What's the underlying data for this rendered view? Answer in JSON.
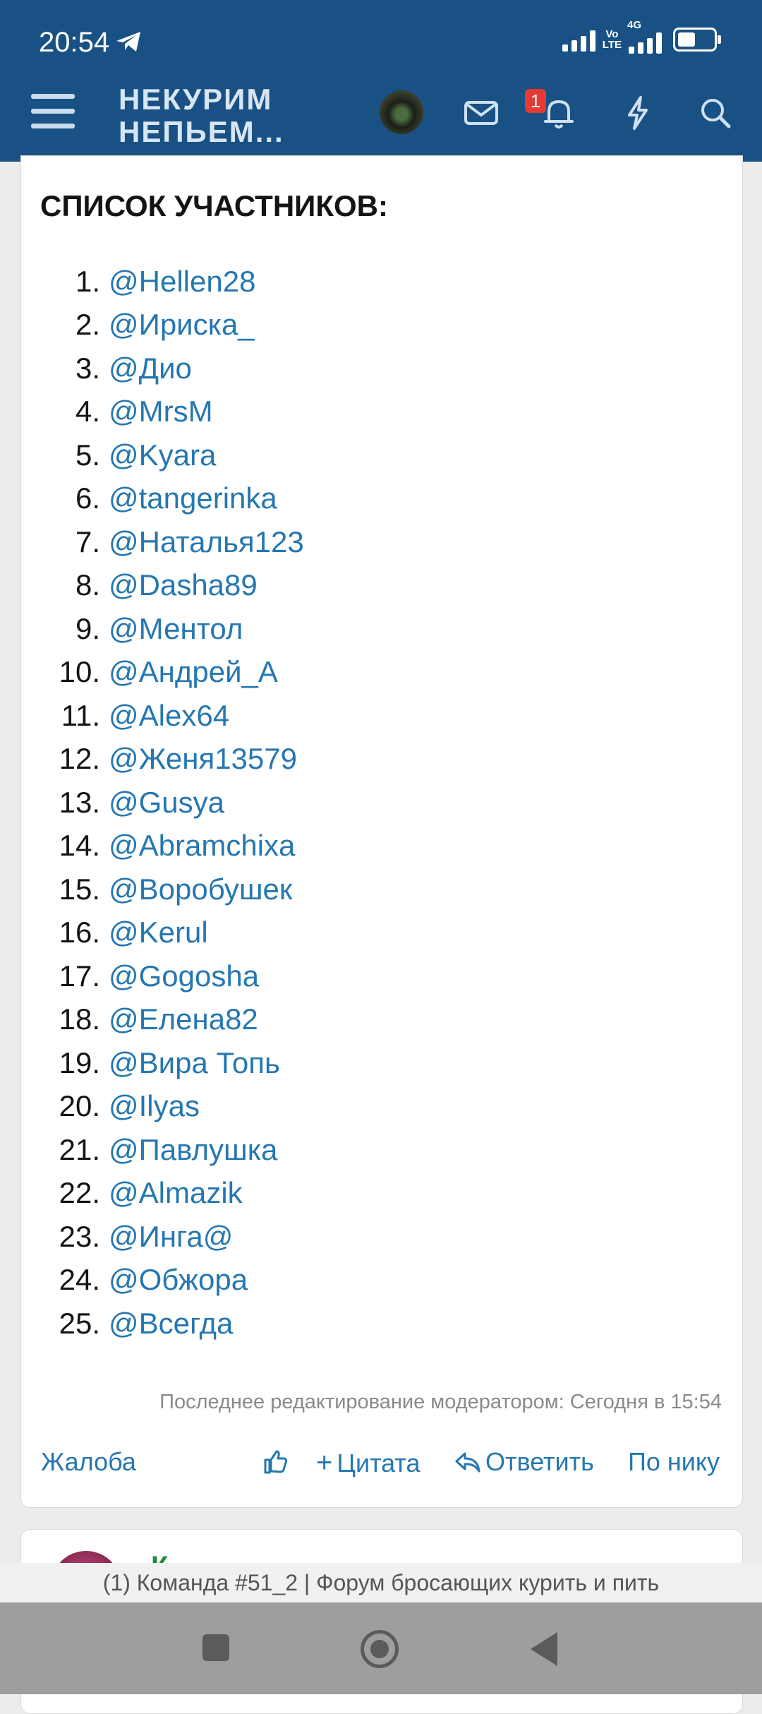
{
  "status_bar": {
    "time": "20:54",
    "net_top": "Vo",
    "net_bottom": "LTE",
    "net_4g": "4G"
  },
  "header": {
    "logo_line1": "НЕКУРИМ",
    "logo_line2": "НЕПЬЕМ...",
    "notification_count": "1"
  },
  "post": {
    "title": "СПИСОК УЧАСТНИКОВ:",
    "participants": [
      {
        "n": "1.",
        "name": "@Hellen28"
      },
      {
        "n": "2.",
        "name": "@Ириска_"
      },
      {
        "n": "3.",
        "name": "@Дио"
      },
      {
        "n": "4.",
        "name": "@MrsM"
      },
      {
        "n": "5.",
        "name": "@Kyara"
      },
      {
        "n": "6.",
        "name": "@tangerinka"
      },
      {
        "n": "7.",
        "name": "@Наталья123"
      },
      {
        "n": "8.",
        "name": "@Dasha89"
      },
      {
        "n": "9.",
        "name": "@Ментол"
      },
      {
        "n": "10.",
        "name": "@Андрей_А"
      },
      {
        "n": "11.",
        "name": "@Alex64"
      },
      {
        "n": "12.",
        "name": "@Женя13579"
      },
      {
        "n": "13.",
        "name": "@Gusya"
      },
      {
        "n": "14.",
        "name": "@Abramchixa"
      },
      {
        "n": "15.",
        "name": "@Воробушек"
      },
      {
        "n": "16.",
        "name": "@Kerul"
      },
      {
        "n": "17.",
        "name": "@Gogosha"
      },
      {
        "n": "18.",
        "name": "@Елена82"
      },
      {
        "n": "19.",
        "name": "@Вира Топь"
      },
      {
        "n": "20.",
        "name": "@Ilyas"
      },
      {
        "n": "21.",
        "name": "@Павлушка"
      },
      {
        "n": "22.",
        "name": "@Almazik"
      },
      {
        "n": "23.",
        "name": "@Инга@"
      },
      {
        "n": "24.",
        "name": "@Обжора"
      },
      {
        "n": "25.",
        "name": "@Всегда"
      }
    ],
    "edited_note": "Последнее редактирование модератором: Сегодня в 15:54",
    "actions": {
      "report": "Жалоба",
      "quote": "Цитата",
      "reply": "Ответить",
      "by_nick": "По нику"
    }
  },
  "next_post": {
    "username_partial": "К"
  },
  "browser": {
    "page_title": "(1) Команда #51_2 | Форум бросающих курить и пить"
  },
  "colors": {
    "header": "#195185",
    "link": "#2577b1"
  }
}
